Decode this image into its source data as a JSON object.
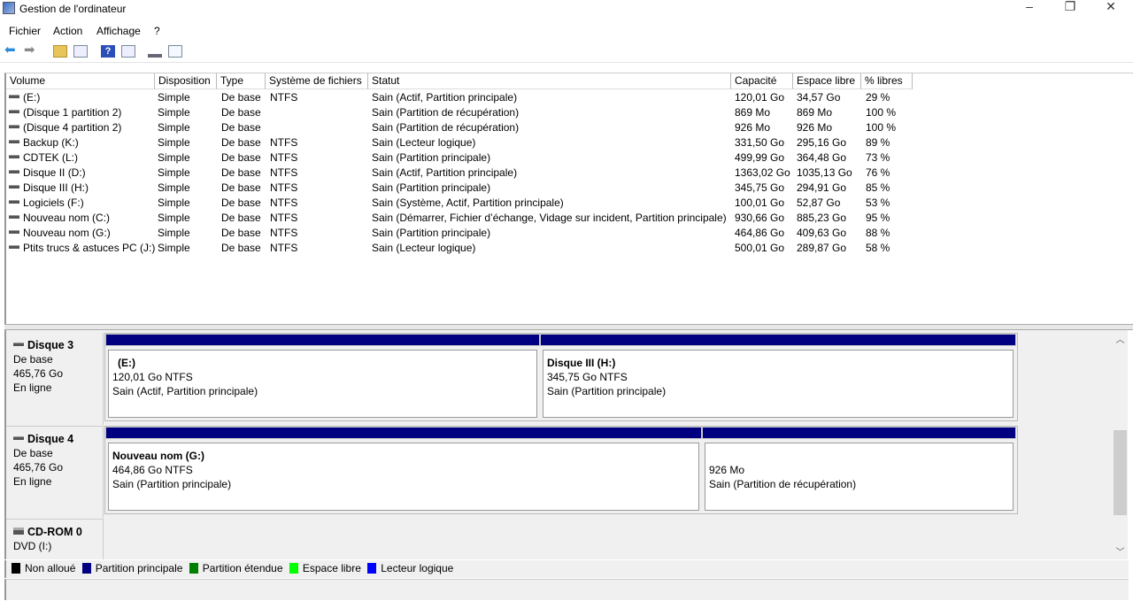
{
  "window": {
    "title": "Gestion de l'ordinateur",
    "minimize": "–",
    "restore": "❐",
    "close": "✕"
  },
  "menu": [
    "Fichier",
    "Action",
    "Affichage",
    "?"
  ],
  "toolbar": [
    "back-icon",
    "forward-icon",
    "up-folder-icon",
    "show-hide-console-tree-icon",
    "help-icon",
    "show-action-pane-icon",
    "connect-disk-icon",
    "properties-icon"
  ],
  "columns": [
    "Volume",
    "Disposition",
    "Type",
    "Système de fichiers",
    "Statut",
    "Capacité",
    "Espace libre",
    "% libres"
  ],
  "volumes": [
    [
      "(E:)",
      "Simple",
      "De base",
      "NTFS",
      "Sain (Actif, Partition principale)",
      "120,01 Go",
      "34,57 Go",
      "29 %"
    ],
    [
      "(Disque 1 partition 2)",
      "Simple",
      "De base",
      "",
      "Sain (Partition de récupération)",
      "869 Mo",
      "869 Mo",
      "100 %"
    ],
    [
      "(Disque 4 partition 2)",
      "Simple",
      "De base",
      "",
      "Sain (Partition de récupération)",
      "926 Mo",
      "926 Mo",
      "100 %"
    ],
    [
      "Backup (K:)",
      "Simple",
      "De base",
      "NTFS",
      "Sain (Lecteur logique)",
      "331,50 Go",
      "295,16 Go",
      "89 %"
    ],
    [
      "CDTEK (L:)",
      "Simple",
      "De base",
      "NTFS",
      "Sain (Partition principale)",
      "499,99 Go",
      "364,48 Go",
      "73 %"
    ],
    [
      "Disque II (D:)",
      "Simple",
      "De base",
      "NTFS",
      "Sain (Actif, Partition principale)",
      "1363,02 Go",
      "1035,13 Go",
      "76 %"
    ],
    [
      "Disque III (H:)",
      "Simple",
      "De base",
      "NTFS",
      "Sain (Partition principale)",
      "345,75 Go",
      "294,91 Go",
      "85 %"
    ],
    [
      "Logiciels (F:)",
      "Simple",
      "De base",
      "NTFS",
      "Sain (Système, Actif, Partition principale)",
      "100,01 Go",
      "52,87 Go",
      "53 %"
    ],
    [
      "Nouveau nom (C:)",
      "Simple",
      "De base",
      "NTFS",
      "Sain (Démarrer, Fichier d’échange, Vidage sur incident, Partition principale)",
      "930,66 Go",
      "885,23 Go",
      "95 %"
    ],
    [
      "Nouveau nom (G:)",
      "Simple",
      "De base",
      "NTFS",
      "Sain (Partition principale)",
      "464,86 Go",
      "409,63 Go",
      "88 %"
    ],
    [
      "Ptits trucs & astuces PC (J:)",
      "Simple",
      "De base",
      "NTFS",
      "Sain (Lecteur logique)",
      "500,01 Go",
      "289,87 Go",
      "58 %"
    ]
  ],
  "disks": [
    {
      "name": "Disque 3",
      "type": "De base",
      "size": "465,76 Go",
      "state": "En ligne",
      "partitions": [
        {
          "name": "(E:)",
          "size": "120,01 Go NTFS",
          "status": "Sain (Actif, Partition principale)"
        },
        {
          "name": "Disque III  (H:)",
          "size": "345,75 Go NTFS",
          "status": "Sain (Partition principale)"
        }
      ]
    },
    {
      "name": "Disque 4",
      "type": "De base",
      "size": "465,76 Go",
      "state": "En ligne",
      "partitions": [
        {
          "name": "Nouveau nom  (G:)",
          "size": "464,86 Go NTFS",
          "status": "Sain (Partition principale)"
        },
        {
          "name": "",
          "size": "926 Mo",
          "status": "Sain (Partition de récupération)"
        }
      ]
    },
    {
      "name": "CD-ROM 0",
      "type": "DVD (I:)"
    }
  ],
  "legend": [
    {
      "label": "Non alloué",
      "color": "#000000"
    },
    {
      "label": "Partition principale",
      "color": "#000080"
    },
    {
      "label": "Partition étendue",
      "color": "#008000"
    },
    {
      "label": "Espace libre",
      "color": "#00ff00"
    },
    {
      "label": "Lecteur logique",
      "color": "#0000ff"
    }
  ]
}
